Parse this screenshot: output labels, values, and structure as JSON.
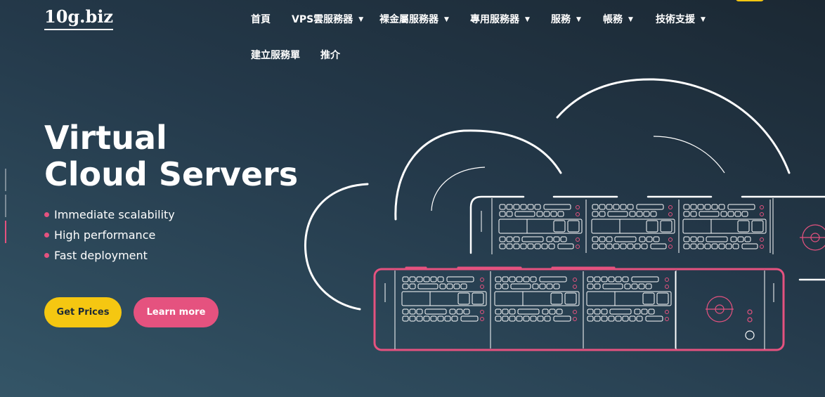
{
  "logo": {
    "text": "10g.biz"
  },
  "nav": {
    "items": [
      {
        "label": "首頁",
        "dropdown": false
      },
      {
        "label": "VPS雲服務器",
        "dropdown": true
      },
      {
        "label": "裸金屬服務器",
        "dropdown": true
      },
      {
        "label": "專用服務器",
        "dropdown": true
      },
      {
        "label": "服務",
        "dropdown": true
      },
      {
        "label": "帳務",
        "dropdown": true
      },
      {
        "label": "技術支援",
        "dropdown": true
      },
      {
        "label": "建立服務單",
        "dropdown": false
      },
      {
        "label": "推介",
        "dropdown": false
      }
    ]
  },
  "hero": {
    "title_line1": "Virtual",
    "title_line2": "Cloud Servers",
    "features": [
      "Immediate scalability",
      "High performance",
      "Fast deployment"
    ],
    "primary_button": "Get Prices",
    "secondary_button": "Learn more"
  },
  "colors": {
    "accent_yellow": "#f5c711",
    "accent_pink": "#e5527f",
    "bg_dark": "#1b2833",
    "bg_light": "#345567"
  }
}
